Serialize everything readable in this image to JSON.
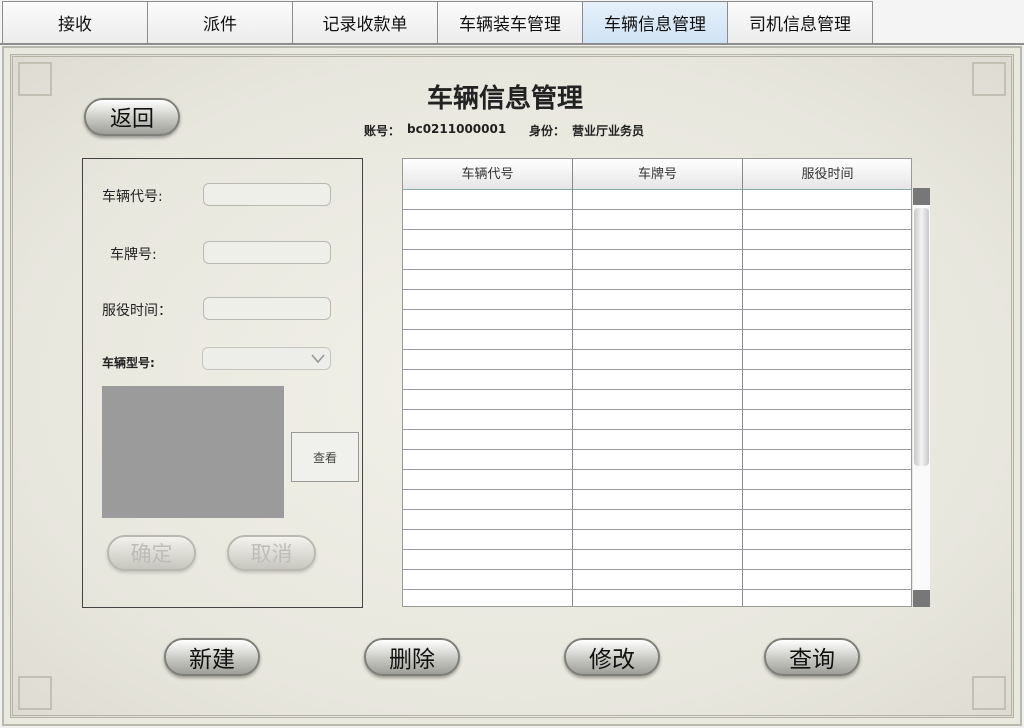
{
  "tabs": [
    {
      "label": "接收"
    },
    {
      "label": "派件"
    },
    {
      "label": "记录收款单"
    },
    {
      "label": "车辆装车管理"
    },
    {
      "label": "车辆信息管理",
      "active": true
    },
    {
      "label": "司机信息管理"
    }
  ],
  "page": {
    "title": "车辆信息管理",
    "account_label": "账号：",
    "account_value": "bc0211000001",
    "role_label": "身份：",
    "role_value": "营业厅业务员",
    "back_button": "返回"
  },
  "form": {
    "vehicle_code_label": "车辆代号:",
    "vehicle_code_value": "",
    "plate_label": "车牌号:",
    "plate_value": "",
    "service_time_label": "服役时间：",
    "service_time_value": "",
    "model_label": "车辆型号:",
    "model_value": "",
    "view_button": "查看",
    "confirm_button": "确定",
    "cancel_button": "取消"
  },
  "table": {
    "columns": [
      "车辆代号",
      "车牌号",
      "服役时间"
    ],
    "rows": []
  },
  "actions": {
    "new_button": "新建",
    "delete_button": "删除",
    "modify_button": "修改",
    "query_button": "查询"
  },
  "colors": {
    "active_tab": "#cfe2f4",
    "frame_bg": "#e9e8de",
    "photo_placeholder": "#9b9b9b"
  }
}
